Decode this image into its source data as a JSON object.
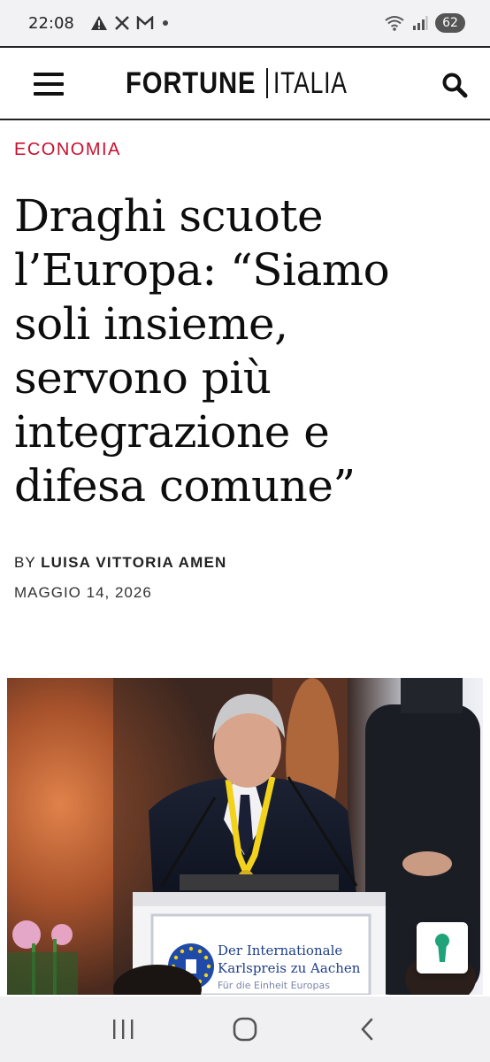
{
  "status_bar": {
    "time": "22:08",
    "left_icons": [
      "warning-icon",
      "x-logo-icon",
      "gmail-icon",
      "dot-icon"
    ],
    "right_icons": [
      "wifi-icon",
      "signal-icon"
    ],
    "battery": "62"
  },
  "header": {
    "logo_primary": "FORTUNE",
    "logo_secondary": "ITALIA",
    "menu_icon": "hamburger-menu-icon",
    "search_icon": "search-icon"
  },
  "article": {
    "category": "ECONOMIA",
    "headline": "Draghi scuote l’Europa: “Siamo soli insieme, servono più integrazione e difesa comune”",
    "byline_prefix": "BY ",
    "author": "LUISA VITTORIA AMEN",
    "date": "MAGGIO 14, 2026"
  },
  "photo": {
    "sign_line1": "Der Internationale",
    "sign_line2": "Karlspreis zu Aachen",
    "sign_line3": "Für die Einheit Europas"
  },
  "colors": {
    "category_red": "#c8102e",
    "lanyard_yellow": "#f2d21b",
    "keyhole_green": "#1fa37a"
  },
  "nav_bar": {
    "recents_icon": "recents-icon",
    "home_icon": "home-icon",
    "back_icon": "back-icon"
  }
}
